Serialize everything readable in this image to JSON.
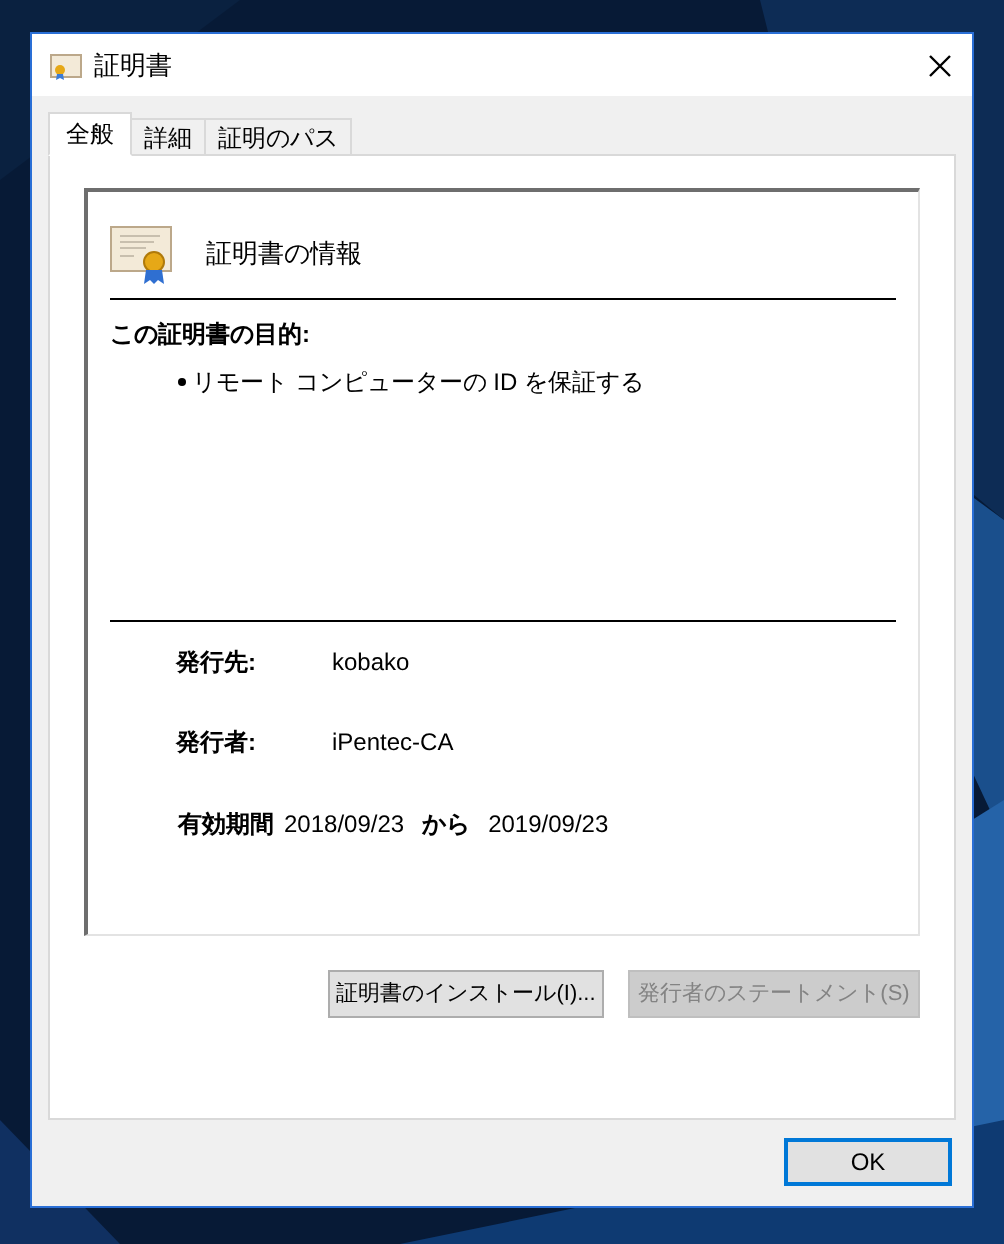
{
  "window": {
    "title": "証明書"
  },
  "tabs": [
    {
      "label": "全般",
      "selected": true
    },
    {
      "label": "詳細",
      "selected": false
    },
    {
      "label": "証明のパス",
      "selected": false
    }
  ],
  "info": {
    "heading": "証明書の情報",
    "purpose_label": "この証明書の目的:",
    "purposes": [
      "リモート コンピューターの ID を保証する"
    ]
  },
  "fields": [
    {
      "label": "発行先:",
      "value": "kobako"
    },
    {
      "label": "発行者:",
      "value": "iPentec-CA"
    }
  ],
  "validity": {
    "label": "有効期間",
    "from": "2018/09/23",
    "connector": "から",
    "to": "2019/09/23"
  },
  "buttons": [
    {
      "label": "証明書のインストール(I)...",
      "disabled": false
    },
    {
      "label": "発行者のステートメント(S)",
      "disabled": true
    }
  ],
  "dialog_buttons": [
    {
      "label": "OK",
      "default": true
    }
  ]
}
